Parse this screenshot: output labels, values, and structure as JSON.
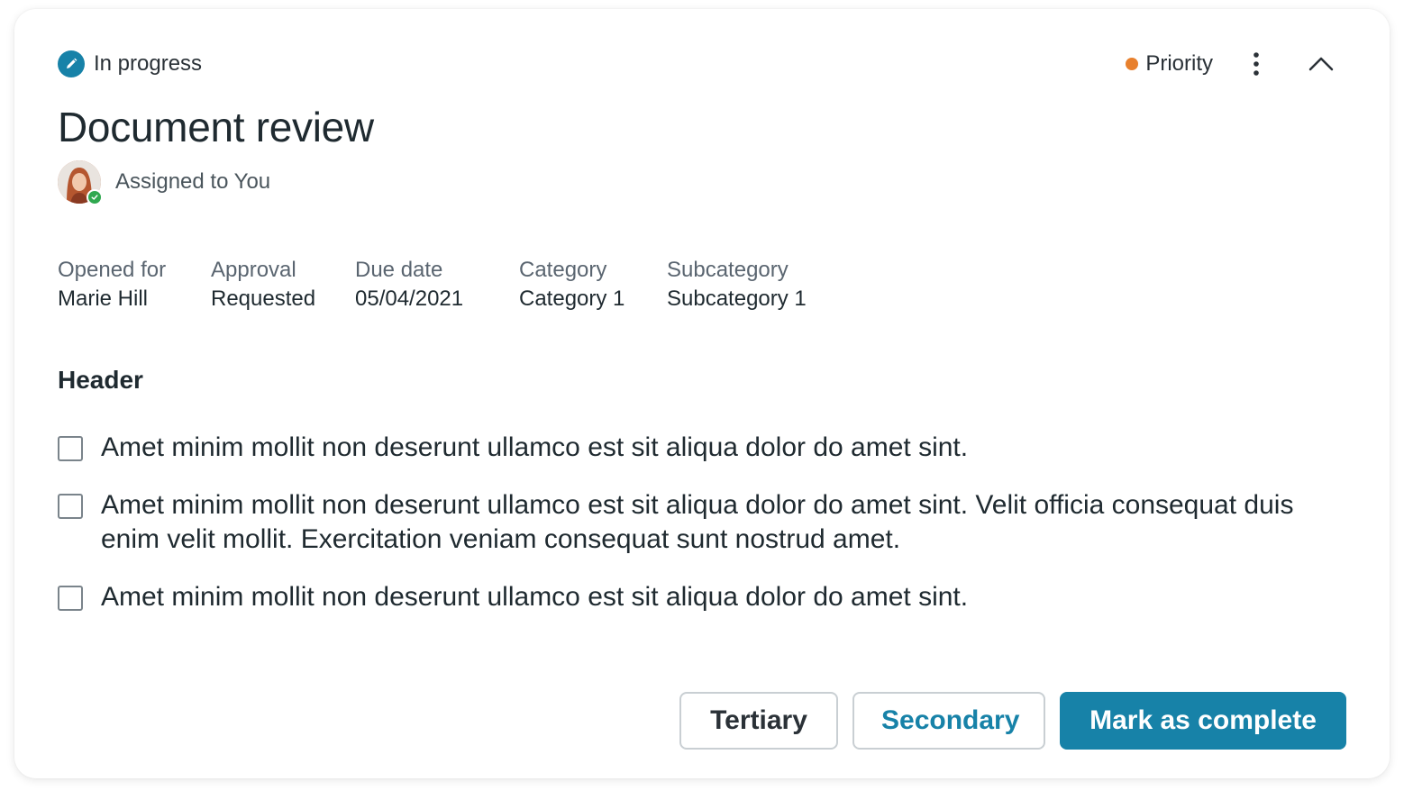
{
  "status": {
    "label": "In progress",
    "icon": "pencil-icon",
    "color": "#1782a8"
  },
  "priority": {
    "label": "Priority",
    "dot_color": "#e8802d"
  },
  "menu": {
    "more_icon": "vertical-ellipsis-icon",
    "collapse_icon": "chevron-up-icon"
  },
  "title": "Document review",
  "assignee": {
    "label": "Assigned to You",
    "presence": "available"
  },
  "fields": [
    {
      "label": "Opened for",
      "value": "Marie Hill"
    },
    {
      "label": "Approval",
      "value": "Requested"
    },
    {
      "label": "Due date",
      "value": "05/04/2021"
    },
    {
      "label": "Category",
      "value": "Category 1"
    },
    {
      "label": "Subcategory",
      "value": "Subcategory 1"
    }
  ],
  "section": {
    "header": "Header"
  },
  "checklist": [
    {
      "text": "Amet minim mollit non deserunt ullamco est sit aliqua dolor do amet sint.",
      "checked": false
    },
    {
      "text": "Amet minim mollit non deserunt ullamco est sit aliqua dolor do amet sint. Velit officia consequat duis enim velit mollit. Exercitation veniam consequat sunt nostrud amet.",
      "checked": false
    },
    {
      "text": "Amet minim mollit non deserunt ullamco est sit aliqua dolor do amet sint.",
      "checked": false
    }
  ],
  "actions": {
    "tertiary": "Tertiary",
    "secondary": "Secondary",
    "primary": "Mark as complete"
  },
  "colors": {
    "accent": "#1782a8",
    "priority": "#e8802d",
    "presence": "#2fa84f"
  }
}
